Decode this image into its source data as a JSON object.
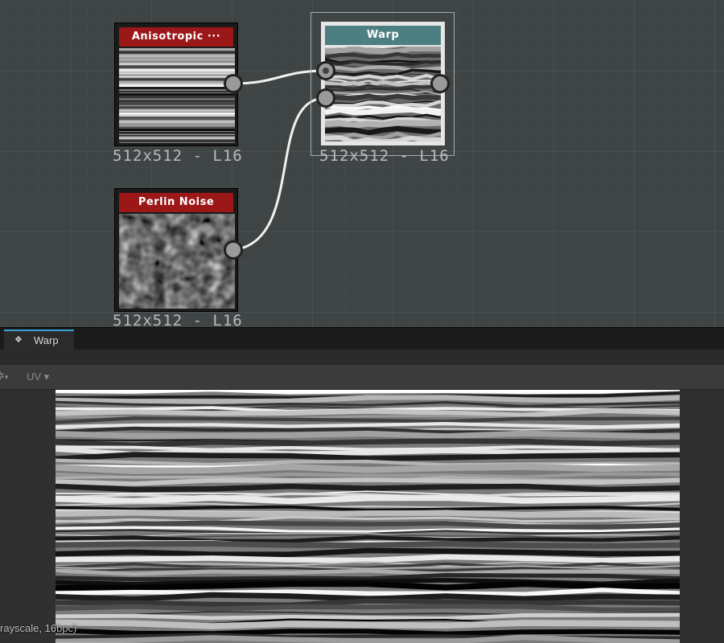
{
  "graph": {
    "nodes": [
      {
        "id": "anisotropic",
        "title": "Anisotropic ···",
        "color": "#9c1717",
        "resolution": "512x512 - L16"
      },
      {
        "id": "perlin",
        "title": "Perlin Noise",
        "color": "#9c1717",
        "resolution": "512x512 - L16"
      },
      {
        "id": "warp",
        "title": "Warp",
        "color": "#4d7f82",
        "resolution": "512x512 - L16"
      }
    ]
  },
  "view2d": {
    "tab_label": "Warp",
    "tab_icon": "texture-view-icon",
    "toolbar": {
      "gear_icon": "gear-icon",
      "gear_caret": "▾",
      "uv_label": "UV ▾"
    },
    "status_text": "rayscale, 16bpc)"
  },
  "colors": {
    "accent": "#3aa2d6",
    "graph_bg": "#3f4545",
    "wire": "#f2f2f2"
  }
}
